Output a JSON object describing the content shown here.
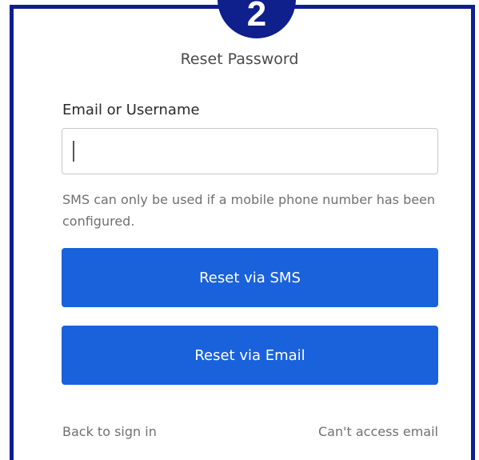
{
  "step_badge": {
    "number": "2"
  },
  "form": {
    "title": "Reset Password",
    "field_label": "Email or Username",
    "field_value": "",
    "field_placeholder": "",
    "helper_text": "SMS can only be used if a mobile phone number has been configured.",
    "sms_button_label": "Reset via SMS",
    "email_button_label": "Reset via Email"
  },
  "footer": {
    "back_link": "Back to sign in",
    "cant_access_link": "Can't access email"
  },
  "colors": {
    "border": "#0f1f8c",
    "primary_button": "#1a62db"
  }
}
